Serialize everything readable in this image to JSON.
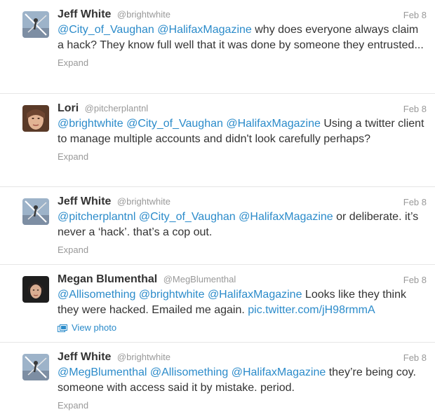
{
  "colors": {
    "link": "#2b8bca",
    "text": "#333333",
    "muted": "#999999",
    "divider": "#e6e6e6"
  },
  "tweets": [
    {
      "avatar_icon": "gymnast-avatar-icon",
      "fullname": "Jeff White",
      "username": "@brightwhite",
      "time": "Feb 8",
      "parts": [
        {
          "t": "@City_of_Vaughan",
          "k": "mention"
        },
        {
          "t": " ",
          "k": "text"
        },
        {
          "t": "@HalifaxMagazine",
          "k": "mention"
        },
        {
          "t": " why does everyone always claim a hack? They know full well that it was done by someone they entrusted...",
          "k": "text"
        }
      ],
      "action": "Expand"
    },
    {
      "avatar_icon": "woman-portrait-avatar-icon",
      "fullname": "Lori",
      "username": "@pitcherplantnl",
      "time": "Feb 8",
      "parts": [
        {
          "t": "@brightwhite",
          "k": "mention"
        },
        {
          "t": " ",
          "k": "text"
        },
        {
          "t": "@City_of_Vaughan",
          "k": "mention"
        },
        {
          "t": " ",
          "k": "text"
        },
        {
          "t": "@HalifaxMagazine",
          "k": "mention"
        },
        {
          "t": " Using a twitter client to manage multiple accounts and didn't look carefully perhaps?",
          "k": "text"
        }
      ],
      "action": "Expand"
    },
    {
      "avatar_icon": "gymnast-avatar-icon",
      "fullname": "Jeff White",
      "username": "@brightwhite",
      "time": "Feb 8",
      "parts": [
        {
          "t": "@pitcherplantnl",
          "k": "mention"
        },
        {
          "t": " ",
          "k": "text"
        },
        {
          "t": "@City_of_Vaughan",
          "k": "mention"
        },
        {
          "t": " ",
          "k": "text"
        },
        {
          "t": "@HalifaxMagazine",
          "k": "mention"
        },
        {
          "t": " or deliberate. it’s never a ‘hack’. that’s a cop out.",
          "k": "text"
        }
      ],
      "action": "Expand"
    },
    {
      "avatar_icon": "woman-dark-hair-avatar-icon",
      "fullname": "Megan Blumenthal",
      "username": "@MegBlumenthal",
      "time": "Feb 8",
      "parts": [
        {
          "t": "@Allisomething",
          "k": "mention"
        },
        {
          "t": " ",
          "k": "text"
        },
        {
          "t": "@brightwhite",
          "k": "mention"
        },
        {
          "t": " ",
          "k": "text"
        },
        {
          "t": "@HalifaxMagazine",
          "k": "mention"
        },
        {
          "t": " Looks like they think they were hacked. Emailed me again. ",
          "k": "text"
        },
        {
          "t": "pic.twitter.com/jH98rmmA",
          "k": "link"
        }
      ],
      "action": "View photo",
      "action_icon": "photo-icon"
    },
    {
      "avatar_icon": "gymnast-avatar-icon",
      "fullname": "Jeff White",
      "username": "@brightwhite",
      "time": "Feb 8",
      "parts": [
        {
          "t": "@MegBlumenthal",
          "k": "mention"
        },
        {
          "t": " ",
          "k": "text"
        },
        {
          "t": "@Allisomething",
          "k": "mention"
        },
        {
          "t": " ",
          "k": "text"
        },
        {
          "t": "@HalifaxMagazine",
          "k": "mention"
        },
        {
          "t": " they’re being coy. someone with access said it by mistake. period.",
          "k": "text"
        }
      ],
      "action": "Expand"
    }
  ]
}
